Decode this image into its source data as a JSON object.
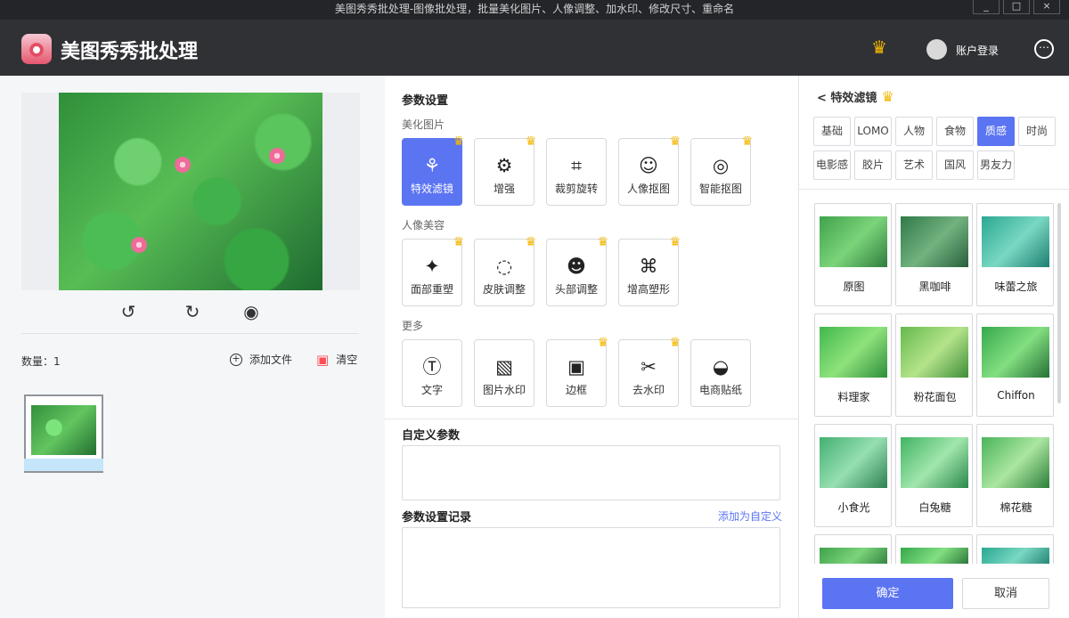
{
  "window": {
    "title": "美图秀秀批处理-图像批处理，批量美化图片、人像调整、加水印、修改尺寸、重命名",
    "controls": [
      "_",
      "□",
      "×"
    ]
  },
  "app": {
    "name": "美图秀秀批处理",
    "login": "账户登录",
    "more": "⋯"
  },
  "left": {
    "count_label": "数量：",
    "count": "1",
    "add_file": "添加文件",
    "clear": "清空",
    "tools": [
      "rotate-left-icon",
      "rotate-right-icon",
      "preview-icon"
    ]
  },
  "middle": {
    "title": "参数设置",
    "sections": [
      {
        "name": "美化图片",
        "items": [
          "特效滤镜",
          "增强",
          "裁剪旋转",
          "人像抠图",
          "智能抠图"
        ]
      },
      {
        "name": "人像美容",
        "items": [
          "面部重塑",
          "皮肤调整",
          "头部调整",
          "增高塑形"
        ]
      },
      {
        "name": "更多",
        "items": [
          "文字",
          "图片水印",
          "边框",
          "去水印",
          "电商贴纸"
        ]
      }
    ],
    "custom_title": "自定义参数",
    "record_title": "参数设置记录",
    "add_custom": "添加为自定义"
  },
  "right": {
    "back": "< 特效滤镜",
    "categories": [
      "基础",
      "LOMO",
      "人物",
      "食物",
      "质感",
      "时尚",
      "电影感",
      "胶片",
      "艺术",
      "国风",
      "男友力"
    ],
    "selected_category": "质感",
    "filters": [
      "原图",
      "黑咖啡",
      "味蕾之旅",
      "料理家",
      "粉花面包",
      "Chiffon",
      "小食光",
      "白兔糖",
      "棉花糖"
    ],
    "ok": "确定",
    "cancel": "取消"
  },
  "colors": {
    "accent": "#5b74f2",
    "crown": "#f5b800",
    "danger": "#ff4d57"
  }
}
